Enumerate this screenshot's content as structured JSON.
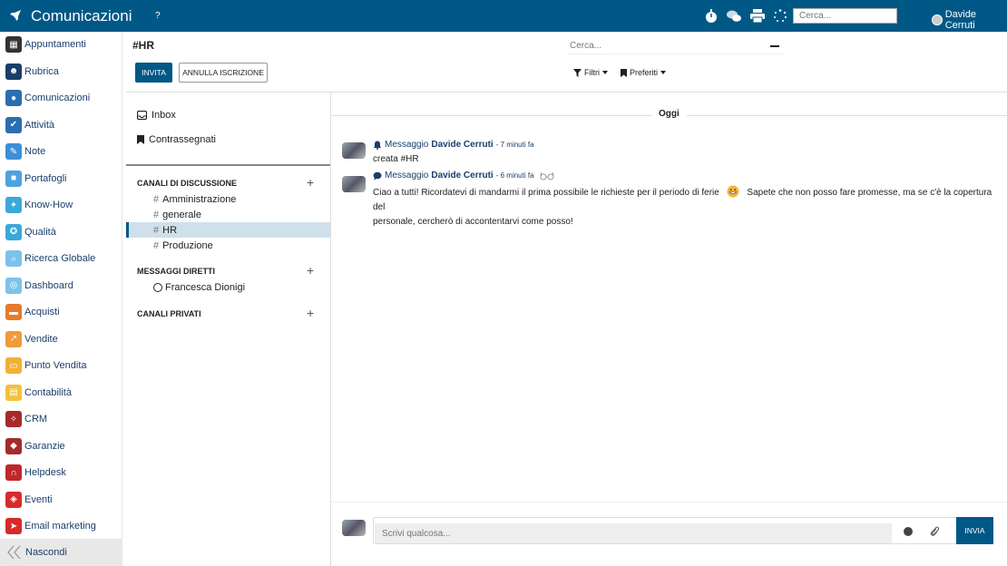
{
  "topbar": {
    "title": "Comunicazioni",
    "help": "?",
    "search_placeholder": "Cerca...",
    "user_name": "Davide Cerruti"
  },
  "sidebar": {
    "items": [
      {
        "label": "Appuntamenti",
        "icon": "calendar-icon",
        "color": "#333333"
      },
      {
        "label": "Rubrica",
        "icon": "contacts-icon",
        "color": "#1a3e6b"
      },
      {
        "label": "Comunicazioni",
        "icon": "chat-icon",
        "color": "#2a6fb0"
      },
      {
        "label": "Attività",
        "icon": "check-icon",
        "color": "#2a6fb0"
      },
      {
        "label": "Note",
        "icon": "note-icon",
        "color": "#3d8fd6"
      },
      {
        "label": "Portafogli",
        "icon": "lock-icon",
        "color": "#4da3e0"
      },
      {
        "label": "Know-How",
        "icon": "bulb-icon",
        "color": "#3aa9d9"
      },
      {
        "label": "Qualità",
        "icon": "quality-icon",
        "color": "#3aa9d9"
      },
      {
        "label": "Ricerca Globale",
        "icon": "search-icon",
        "color": "#7cc2ea"
      },
      {
        "label": "Dashboard",
        "icon": "dashboard-icon",
        "color": "#7cc2ea"
      },
      {
        "label": "Acquisti",
        "icon": "purchase-icon",
        "color": "#e8792b"
      },
      {
        "label": "Vendite",
        "icon": "sales-icon",
        "color": "#ef9a3b"
      },
      {
        "label": "Punto Vendita",
        "icon": "pos-icon",
        "color": "#f2b134"
      },
      {
        "label": "Contabilità",
        "icon": "accounting-icon",
        "color": "#f5c13a"
      },
      {
        "label": "CRM",
        "icon": "handshake-icon",
        "color": "#a52a2a"
      },
      {
        "label": "Garanzie",
        "icon": "shield-icon",
        "color": "#a52a2a"
      },
      {
        "label": "Helpdesk",
        "icon": "headset-icon",
        "color": "#c0272d"
      },
      {
        "label": "Eventi",
        "icon": "ticket-icon",
        "color": "#d72b2b"
      },
      {
        "label": "Email marketing",
        "icon": "paper-plane-icon",
        "color": "#d72b2b"
      }
    ],
    "hide_label": "Nascondi"
  },
  "header": {
    "channel_title": "#HR",
    "invite_label": "INVITA",
    "unsubscribe_label": "ANNULLA ISCRIZIONE",
    "search_placeholder": "Cerca...",
    "filters_label": "Filtri",
    "favorites_label": "Preferiti"
  },
  "channels_panel": {
    "inbox_label": "Inbox",
    "starred_label": "Contrassegnati",
    "discussion_title": "CANALI DI DISCUSSIONE",
    "channels": [
      "Amministrazione",
      "generale",
      "HR",
      "Produzione"
    ],
    "active_channel": "HR",
    "direct_title": "MESSAGGI DIRETTI",
    "direct_messages": [
      "Francesca Dionigi"
    ],
    "private_title": "CANALI PRIVATI"
  },
  "messages": {
    "day_separator": "Oggi",
    "items": [
      {
        "type_label": "Messaggio",
        "author": "Davide Cerruti",
        "time": "- 7 minuti fa",
        "body": "creata #HR"
      },
      {
        "type_label": "Messaggio",
        "author": "Davide Cerruti",
        "time": "- 6 minuti fa",
        "body_part1": "Ciao a tutti! Ricordatevi di mandarmi il prima possibile le richieste per il periodo di ferie",
        "body_part2": "Sapete che non posso fare promesse, ma se c'è la copertura del",
        "body_line2": "personale, cercherò di accontentarvi come posso!"
      }
    ]
  },
  "composer": {
    "placeholder": "Scrivi qualcosa...",
    "send_label": "INVIA"
  }
}
